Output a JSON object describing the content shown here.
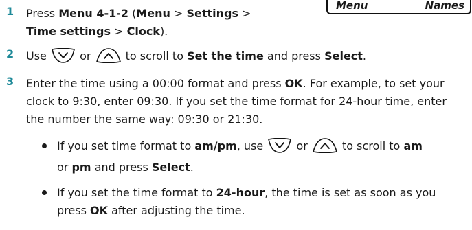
{
  "softkeys": {
    "left": "Menu",
    "right": "Names"
  },
  "steps": [
    {
      "number": "1",
      "lead": "Press ",
      "menu_path": "Menu 4-1-2",
      "open": " (",
      "m1": "Menu",
      "sep1": " > ",
      "m2": "Settings",
      "sep2": " > ",
      "m3": "Time settings",
      "sep3": " > ",
      "m4": "Clock",
      "close": ")."
    },
    {
      "number": "2",
      "use": "Use",
      "or": "or",
      "to_scroll": "to scroll to",
      "target": "Set the time",
      "and_press": "and press",
      "select": "Select",
      "end": "."
    },
    {
      "number": "3",
      "a": "Enter the time using a 00:00 format and press ",
      "ok": "OK",
      "b": ". For example, to set your clock to 9:30, enter 09:30. If you set the time format for 24-hour time, enter the number the same way: 09:30 or 21:30."
    }
  ],
  "bullets": [
    {
      "a": "If you set time format to ",
      "ampm": "am/pm",
      "b": ", use",
      "or": "or",
      "c": "to scroll to",
      "am": "am",
      "or2": "or",
      "pm": "pm",
      "d": "and press",
      "select": "Select",
      "e": "."
    },
    {
      "a": "If you set the time format to ",
      "h24": "24-hour",
      "b": ", the time is set as soon as you press ",
      "ok": "OK",
      "c": " after adjusting the time."
    }
  ],
  "icons": {
    "down": "scroll-down-key-icon",
    "up": "scroll-up-key-icon"
  },
  "colors": {
    "step_number": "#1f8a99"
  }
}
